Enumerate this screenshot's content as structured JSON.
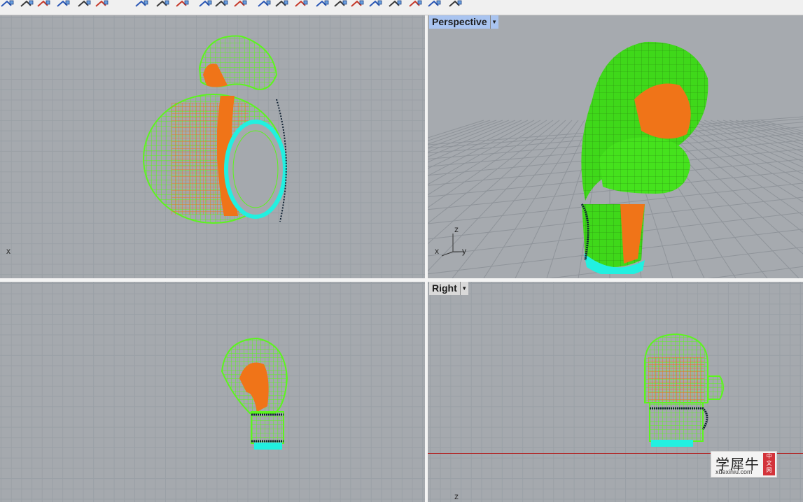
{
  "toolbar": {
    "icons": [
      "curve-tool-icon",
      "solid-box-icon",
      "array-icon",
      "group-icon",
      "surface-icon",
      "point-icon",
      "analyze-icon",
      "transform-icon",
      "dimension-icon",
      "mesh-icon",
      "render-icon",
      "snap-icon",
      "boolean-icon",
      "fillet-icon",
      "shell-icon",
      "blend-icon",
      "network-icon",
      "sweep-icon",
      "loft-icon",
      "revolve-icon",
      "panel-icon",
      "grid-panel-icon",
      "export-icon"
    ]
  },
  "viewports": {
    "perspective": {
      "title": "Perspective",
      "active": true,
      "axes": {
        "x": "x",
        "y": "y",
        "z": "z"
      }
    },
    "right": {
      "title": "Right"
    },
    "top": {
      "axis_x": "x"
    },
    "front": {},
    "right_view_axis": {
      "z": "z"
    }
  },
  "watermark": {
    "chinese": "学犀牛",
    "seal": "中文网",
    "url": "xuexiniu.com"
  },
  "colors": {
    "viewport_bg": "#a5a9ae",
    "grid": "#9aa0a6",
    "wire_green": "#5cf51e",
    "surface_green": "#3fd81a",
    "surface_orange": "#f07418",
    "cyan": "#22f0e0",
    "active_title": "#a9c4f0"
  }
}
